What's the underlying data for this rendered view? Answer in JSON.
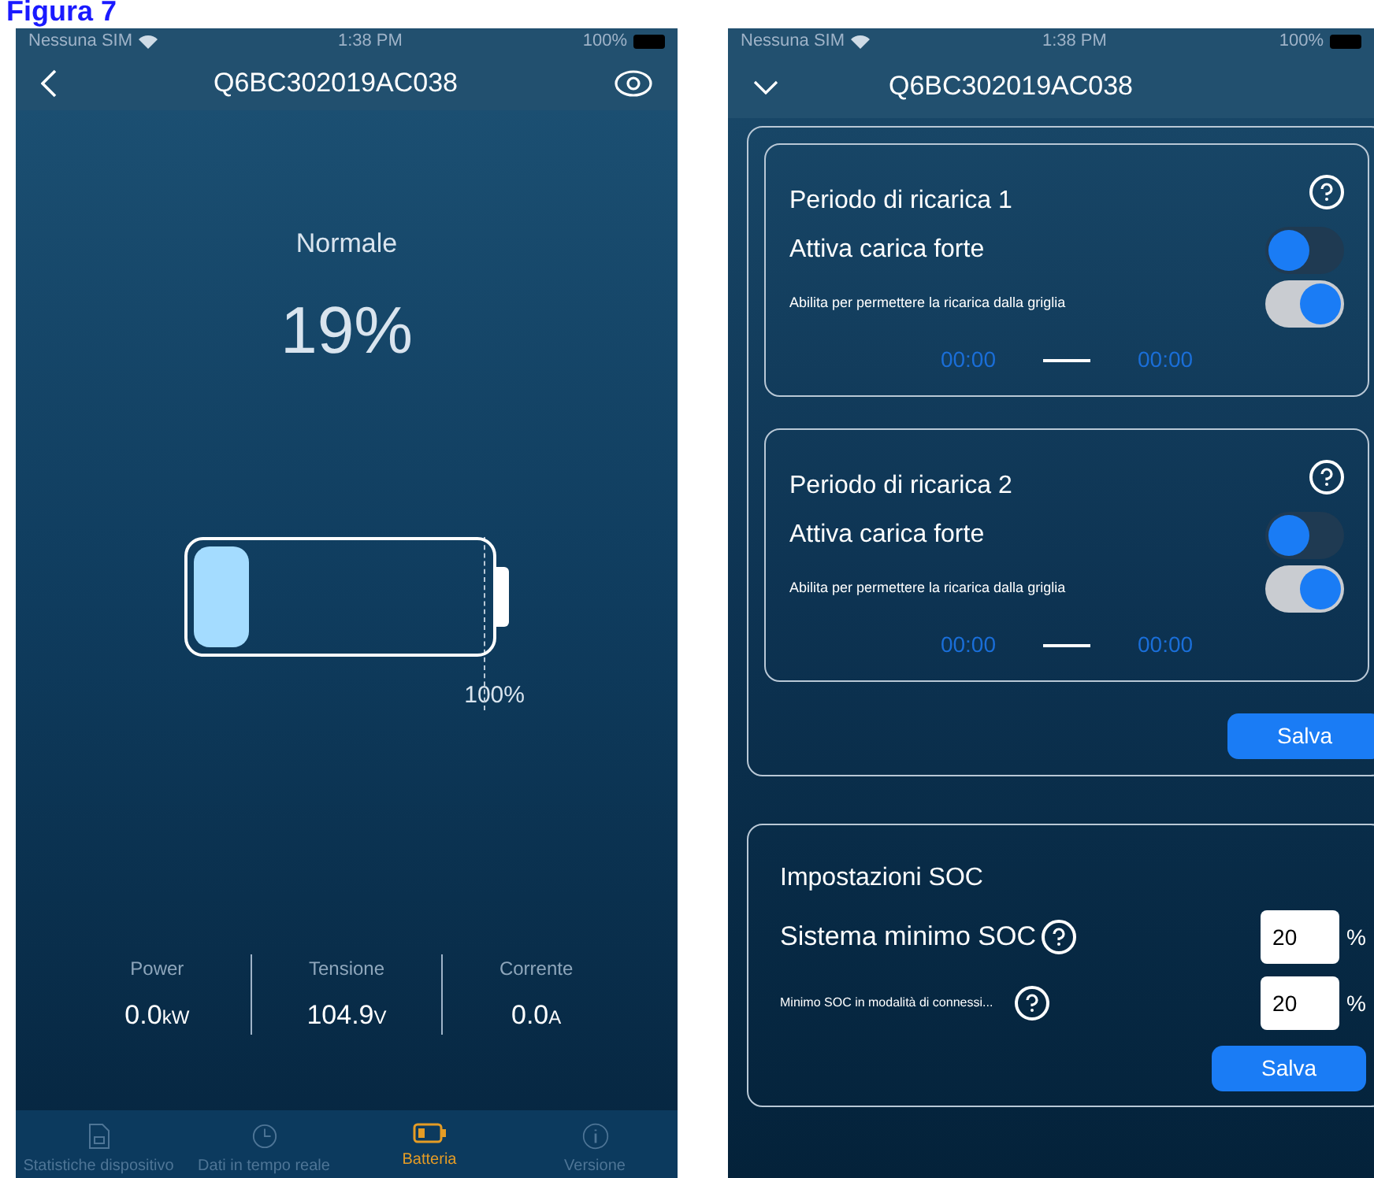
{
  "caption": "Figura 7",
  "left_screen": {
    "status_bar": {
      "carrier": "Nessuna SIM",
      "time": "1:38 PM",
      "battery": "100%"
    },
    "title": "Q6BC302019AC038",
    "battery": {
      "status": "Normale",
      "percent": "19%",
      "level": 0.19,
      "full_label": "100%"
    },
    "metrics": [
      {
        "label": "Power",
        "value": "0.0",
        "unit": "kW"
      },
      {
        "label": "Tensione",
        "value": "104.9",
        "unit": "V"
      },
      {
        "label": "Corrente",
        "value": "0.0",
        "unit": "A"
      }
    ],
    "tabs": [
      {
        "label": "Statistiche dispositivo",
        "kind": "document",
        "selected": false
      },
      {
        "label": "Dati in tempo reale",
        "kind": "clock",
        "selected": false
      },
      {
        "label": "Batteria",
        "kind": "battery",
        "selected": true
      },
      {
        "label": "Versione",
        "kind": "info",
        "selected": false
      }
    ]
  },
  "right_screen": {
    "status_bar": {
      "carrier": "Nessuna SIM",
      "time": "1:38 PM",
      "battery": "100%"
    },
    "title": "Q6BC302019AC038",
    "periods": [
      {
        "title": "Periodo di ricarica 1",
        "force_label": "Attiva carica forte",
        "force_on": false,
        "grid_label": "Abilita per permettere la ricarica dalla griglia",
        "grid_on": true,
        "start": "00:00",
        "end": "00:00"
      },
      {
        "title": "Periodo di ricarica 2",
        "force_label": "Attiva carica forte",
        "force_on": false,
        "grid_label": "Abilita per permettere la ricarica dalla griglia",
        "grid_on": true,
        "start": "00:00",
        "end": "00:00"
      }
    ],
    "save_button": "Salva",
    "soc": {
      "title": "Impostazioni SOC",
      "rows": [
        {
          "label": "Sistema minimo SOC",
          "value": "20",
          "unit": "%",
          "kind": "large"
        },
        {
          "label": "Minimo SOC in modalità di connessi...",
          "value": "20",
          "unit": "%",
          "kind": "small"
        }
      ],
      "save_button": "Salva"
    }
  }
}
